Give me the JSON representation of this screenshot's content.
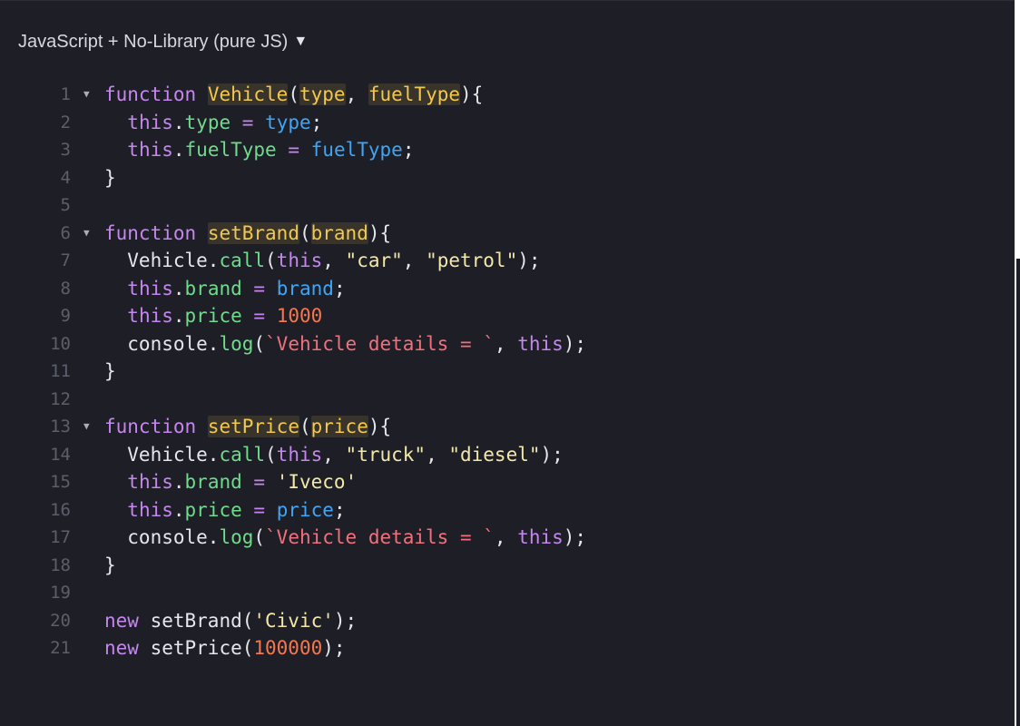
{
  "header": {
    "language_label": "JavaScript + No-Library (pure JS)",
    "caret_icon": "triangle-down-icon",
    "caret_glyph": "▼"
  },
  "colors": {
    "background": "#1e1f26",
    "keyword": "#c586f0",
    "function_name": "#f3c84f",
    "property": "#6fdc8c",
    "variable": "#3ea6f5",
    "string": "#f4e8a8",
    "template_string": "#f1707d",
    "number": "#f5774f",
    "line_number": "#5b5f6b"
  },
  "code": {
    "lines": [
      {
        "n": "1",
        "fold": true,
        "tokens": [
          [
            "kw",
            "function"
          ],
          [
            "plain",
            " "
          ],
          [
            "fnname",
            "Vehicle"
          ],
          [
            "plain",
            "("
          ],
          [
            "param",
            "type"
          ],
          [
            "plain",
            ", "
          ],
          [
            "param",
            "fuelType"
          ],
          [
            "plain",
            "){"
          ]
        ]
      },
      {
        "n": "2",
        "fold": false,
        "tokens": [
          [
            "plain",
            "  "
          ],
          [
            "this",
            "this"
          ],
          [
            "plain",
            "."
          ],
          [
            "prop",
            "type"
          ],
          [
            "plain",
            " "
          ],
          [
            "op",
            "="
          ],
          [
            "plain",
            " "
          ],
          [
            "var",
            "type"
          ],
          [
            "plain",
            ";"
          ]
        ]
      },
      {
        "n": "3",
        "fold": false,
        "tokens": [
          [
            "plain",
            "  "
          ],
          [
            "this",
            "this"
          ],
          [
            "plain",
            "."
          ],
          [
            "prop",
            "fuelType"
          ],
          [
            "plain",
            " "
          ],
          [
            "op",
            "="
          ],
          [
            "plain",
            " "
          ],
          [
            "var",
            "fuelType"
          ],
          [
            "plain",
            ";"
          ]
        ]
      },
      {
        "n": "4",
        "fold": false,
        "tokens": [
          [
            "plain",
            "}"
          ]
        ]
      },
      {
        "n": "5",
        "fold": false,
        "tokens": []
      },
      {
        "n": "6",
        "fold": true,
        "tokens": [
          [
            "kw",
            "function"
          ],
          [
            "plain",
            " "
          ],
          [
            "fnname",
            "setBrand"
          ],
          [
            "plain",
            "("
          ],
          [
            "param",
            "brand"
          ],
          [
            "plain",
            "){"
          ]
        ]
      },
      {
        "n": "7",
        "fold": false,
        "tokens": [
          [
            "plain",
            "  Vehicle."
          ],
          [
            "prop",
            "call"
          ],
          [
            "plain",
            "("
          ],
          [
            "this",
            "this"
          ],
          [
            "plain",
            ", "
          ],
          [
            "str",
            "\"car\""
          ],
          [
            "plain",
            ", "
          ],
          [
            "str",
            "\"petrol\""
          ],
          [
            "plain",
            ");"
          ]
        ]
      },
      {
        "n": "8",
        "fold": false,
        "tokens": [
          [
            "plain",
            "  "
          ],
          [
            "this",
            "this"
          ],
          [
            "plain",
            "."
          ],
          [
            "prop",
            "brand"
          ],
          [
            "plain",
            " "
          ],
          [
            "op",
            "="
          ],
          [
            "plain",
            " "
          ],
          [
            "var",
            "brand"
          ],
          [
            "plain",
            ";"
          ]
        ]
      },
      {
        "n": "9",
        "fold": false,
        "tokens": [
          [
            "plain",
            "  "
          ],
          [
            "this",
            "this"
          ],
          [
            "plain",
            "."
          ],
          [
            "prop",
            "price"
          ],
          [
            "plain",
            " "
          ],
          [
            "op",
            "="
          ],
          [
            "plain",
            " "
          ],
          [
            "num",
            "1000"
          ]
        ]
      },
      {
        "n": "10",
        "fold": false,
        "tokens": [
          [
            "plain",
            "  console."
          ],
          [
            "prop",
            "log"
          ],
          [
            "plain",
            "("
          ],
          [
            "tmpl",
            "`Vehicle details = `"
          ],
          [
            "plain",
            ", "
          ],
          [
            "this",
            "this"
          ],
          [
            "plain",
            ");"
          ]
        ]
      },
      {
        "n": "11",
        "fold": false,
        "tokens": [
          [
            "plain",
            "}"
          ]
        ]
      },
      {
        "n": "12",
        "fold": false,
        "tokens": []
      },
      {
        "n": "13",
        "fold": true,
        "tokens": [
          [
            "kw",
            "function"
          ],
          [
            "plain",
            " "
          ],
          [
            "fnname",
            "setPrice"
          ],
          [
            "plain",
            "("
          ],
          [
            "param",
            "price"
          ],
          [
            "plain",
            "){"
          ]
        ]
      },
      {
        "n": "14",
        "fold": false,
        "tokens": [
          [
            "plain",
            "  Vehicle."
          ],
          [
            "prop",
            "call"
          ],
          [
            "plain",
            "("
          ],
          [
            "this",
            "this"
          ],
          [
            "plain",
            ", "
          ],
          [
            "str",
            "\"truck\""
          ],
          [
            "plain",
            ", "
          ],
          [
            "str",
            "\"diesel\""
          ],
          [
            "plain",
            ");"
          ]
        ]
      },
      {
        "n": "15",
        "fold": false,
        "tokens": [
          [
            "plain",
            "  "
          ],
          [
            "this",
            "this"
          ],
          [
            "plain",
            "."
          ],
          [
            "prop",
            "brand"
          ],
          [
            "plain",
            " "
          ],
          [
            "op",
            "="
          ],
          [
            "plain",
            " "
          ],
          [
            "str",
            "'Iveco'"
          ]
        ]
      },
      {
        "n": "16",
        "fold": false,
        "tokens": [
          [
            "plain",
            "  "
          ],
          [
            "this",
            "this"
          ],
          [
            "plain",
            "."
          ],
          [
            "prop",
            "price"
          ],
          [
            "plain",
            " "
          ],
          [
            "op",
            "="
          ],
          [
            "plain",
            " "
          ],
          [
            "var",
            "price"
          ],
          [
            "plain",
            ";"
          ]
        ]
      },
      {
        "n": "17",
        "fold": false,
        "tokens": [
          [
            "plain",
            "  console."
          ],
          [
            "prop",
            "log"
          ],
          [
            "plain",
            "("
          ],
          [
            "tmpl",
            "`Vehicle details = `"
          ],
          [
            "plain",
            ", "
          ],
          [
            "this",
            "this"
          ],
          [
            "plain",
            ");"
          ]
        ]
      },
      {
        "n": "18",
        "fold": false,
        "tokens": [
          [
            "plain",
            "}"
          ]
        ]
      },
      {
        "n": "19",
        "fold": false,
        "tokens": []
      },
      {
        "n": "20",
        "fold": false,
        "tokens": [
          [
            "kw",
            "new"
          ],
          [
            "plain",
            " setBrand("
          ],
          [
            "str",
            "'Civic'"
          ],
          [
            "plain",
            ");"
          ]
        ]
      },
      {
        "n": "21",
        "fold": false,
        "tokens": [
          [
            "kw",
            "new"
          ],
          [
            "plain",
            " setPrice("
          ],
          [
            "num",
            "100000"
          ],
          [
            "plain",
            ");"
          ]
        ]
      }
    ]
  }
}
